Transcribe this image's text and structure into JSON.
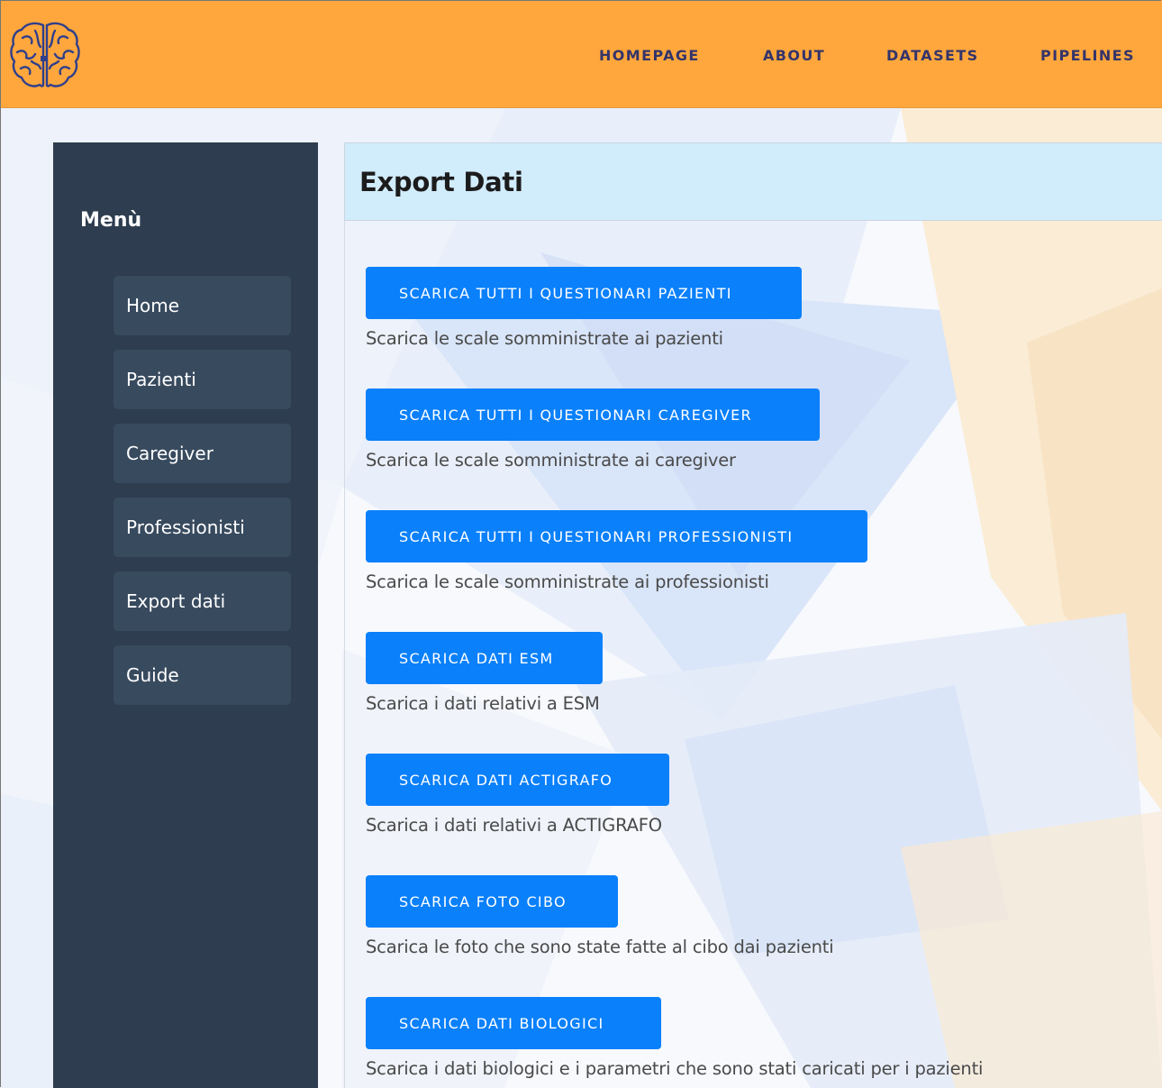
{
  "header": {
    "logo_icon": "brain-icon",
    "nav": [
      {
        "label": "HOMEPAGE"
      },
      {
        "label": "ABOUT"
      },
      {
        "label": "DATASETS"
      },
      {
        "label": "PIPELINES"
      }
    ],
    "colors": {
      "background": "#ffa73c",
      "nav_text": "#34346b"
    }
  },
  "sidebar": {
    "title": "Menù",
    "items": [
      {
        "label": "Home"
      },
      {
        "label": "Pazienti"
      },
      {
        "label": "Caregiver"
      },
      {
        "label": "Professionisti"
      },
      {
        "label": "Export dati"
      },
      {
        "label": "Guide"
      }
    ],
    "colors": {
      "background": "#2e3d4f",
      "item": "#384a5e"
    }
  },
  "main": {
    "title": "Export Dati",
    "exports": [
      {
        "button": "SCARICA TUTTI I QUESTIONARI PAZIENTI",
        "description": "Scarica le scale somministrate ai pazienti"
      },
      {
        "button": "SCARICA TUTTI I QUESTIONARI CAREGIVER",
        "description": "Scarica le scale somministrate ai caregiver"
      },
      {
        "button": "SCARICA TUTTI I QUESTIONARI PROFESSIONISTI",
        "description": "Scarica le scale somministrate ai professionisti"
      },
      {
        "button": "SCARICA DATI ESM",
        "description": "Scarica i dati relativi a ESM"
      },
      {
        "button": "SCARICA DATI ACTIGRAFO",
        "description": "Scarica i dati relativi a ACTIGRAFO"
      },
      {
        "button": "SCARICA FOTO CIBO",
        "description": "Scarica le foto che sono state fatte al cibo dai pazienti"
      },
      {
        "button": "SCARICA DATI BIOLOGICI",
        "description": "Scarica i dati biologici e i parametri che sono stati caricati per i pazienti"
      }
    ],
    "colors": {
      "header_bg": "#d1ecfb",
      "button": "#0a80fb"
    }
  }
}
